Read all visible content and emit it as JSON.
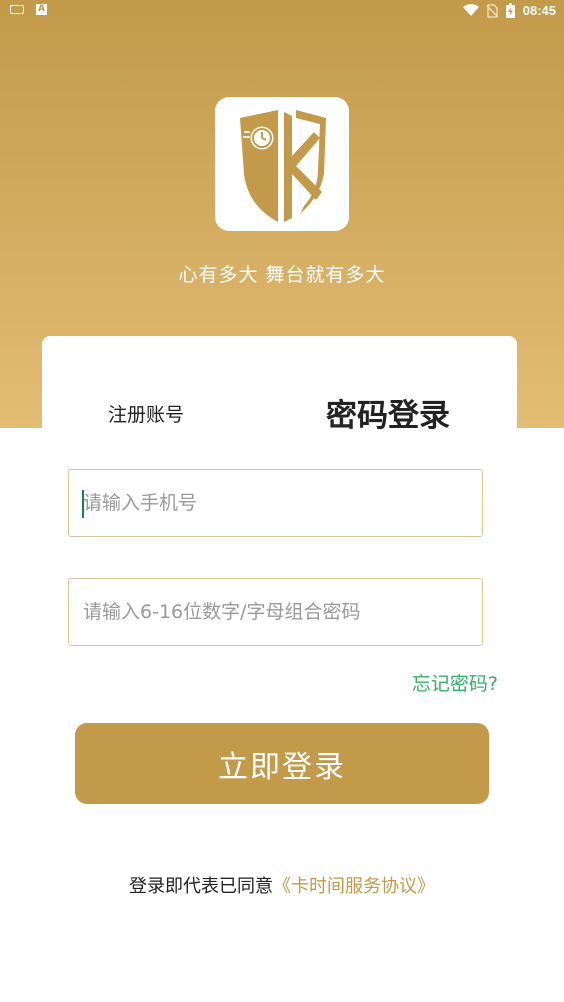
{
  "status_bar": {
    "time": "08:45",
    "left_icons": [
      "keyboard-icon",
      "a-icon"
    ],
    "right_icons": [
      "wifi-icon",
      "no-sim-icon",
      "battery-icon"
    ]
  },
  "hero": {
    "slogan": "心有多大  舞台就有多大",
    "logo_icon": "shield-clock-logo",
    "gradient_top": "#c39a49",
    "gradient_bottom": "#e4bd74"
  },
  "tabs": {
    "register": "注册账号",
    "login": "密码登录"
  },
  "form": {
    "phone_placeholder": "请输入手机号",
    "phone_value": "",
    "password_placeholder": "请输入6-16位数字/字母组合密码",
    "password_value": ""
  },
  "forgot_label": "忘记密码?",
  "login_button": "立即登录",
  "agreement": {
    "prefix": "登录即代表已同意",
    "link": "《卡时间服务协议》"
  },
  "colors": {
    "accent": "#c39a49",
    "link_green": "#35b06a"
  }
}
